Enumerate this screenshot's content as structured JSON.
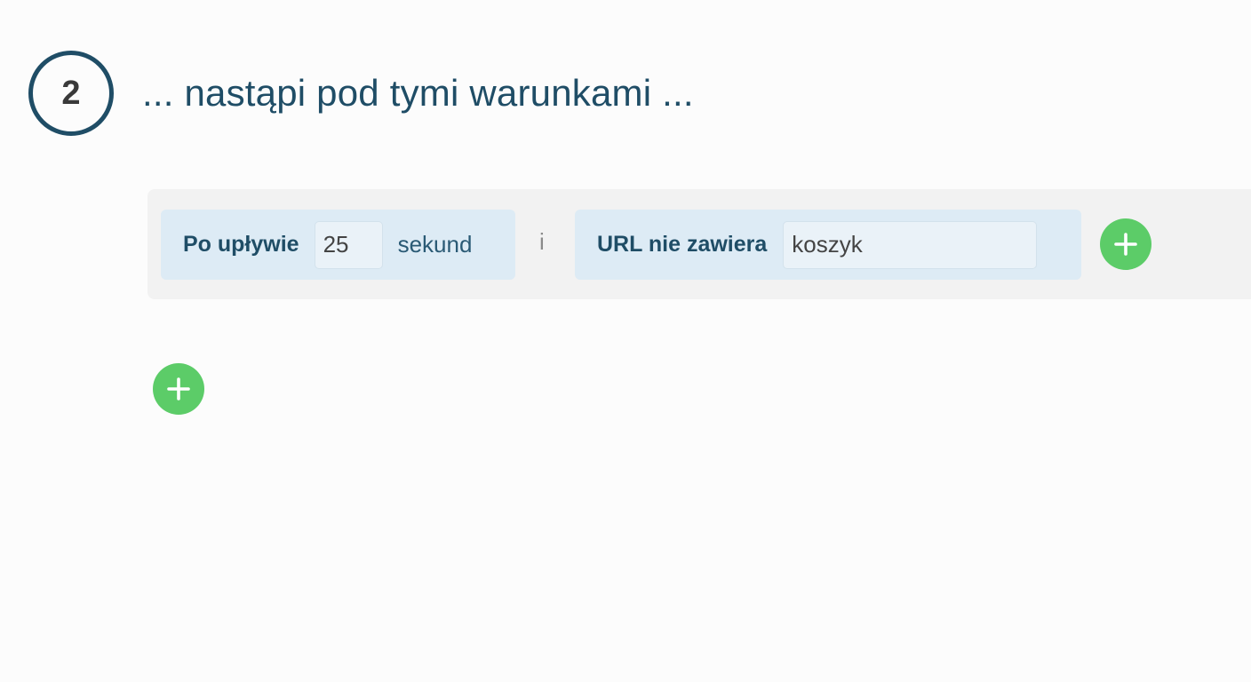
{
  "step": {
    "number": "2",
    "title": "... nastąpi pod tymi warunkami ..."
  },
  "conditions": {
    "time": {
      "label": "Po upływie",
      "value": "25",
      "unit": "sekund"
    },
    "connector": "i",
    "url": {
      "label": "URL nie zawiera",
      "value": "koszyk"
    }
  },
  "icons": {
    "add_condition": "plus-icon",
    "add_group": "plus-icon"
  },
  "colors": {
    "primary": "#1f4d66",
    "condition_bg": "#ddebf5",
    "group_bg": "#f2f2f2",
    "add_button": "#5ccc68"
  }
}
